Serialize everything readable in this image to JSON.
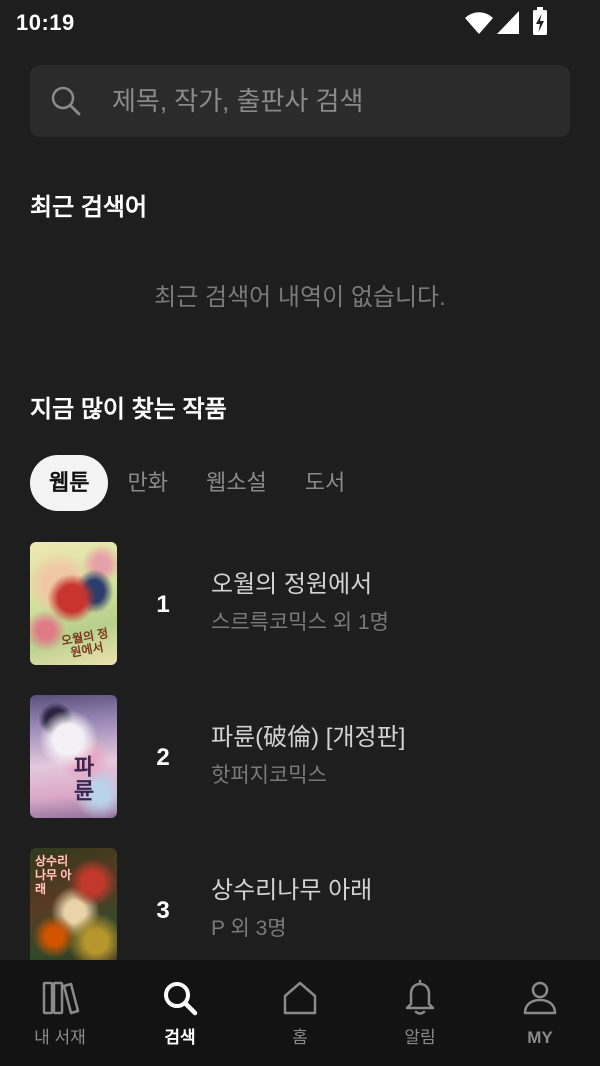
{
  "status_bar": {
    "time": "10:19",
    "icons": [
      "wifi-icon",
      "signal-icon",
      "battery-charging-icon"
    ]
  },
  "search": {
    "placeholder": "제목, 작가, 출판사 검색",
    "value": "",
    "icon": "search-icon"
  },
  "recent_searches": {
    "title": "최근 검색어",
    "empty_message": "최근 검색어 내역이 없습니다."
  },
  "popular": {
    "title": "지금 많이 찾는 작품",
    "tabs": [
      {
        "label": "웹툰",
        "selected": true
      },
      {
        "label": "만화",
        "selected": false
      },
      {
        "label": "웹소설",
        "selected": false
      },
      {
        "label": "도서",
        "selected": false
      }
    ],
    "items": [
      {
        "rank": "1",
        "title": "오월의 정원에서",
        "author": "스르륵코믹스 외 1명",
        "cover_text": "오월의 정원에서"
      },
      {
        "rank": "2",
        "title": "파륜(破倫) [개정판]",
        "author": "핫퍼지코믹스",
        "cover_text": "파륜"
      },
      {
        "rank": "3",
        "title": "상수리나무 아래",
        "author": "P 외 3명",
        "cover_text": "상수리나무 아래"
      }
    ]
  },
  "bottom_nav": {
    "items": [
      {
        "label": "내 서재",
        "icon": "library-icon",
        "active": false
      },
      {
        "label": "검색",
        "icon": "search-icon",
        "active": true
      },
      {
        "label": "홈",
        "icon": "home-icon",
        "active": false
      },
      {
        "label": "알림",
        "icon": "bell-icon",
        "active": false
      },
      {
        "label": "MY",
        "icon": "person-icon",
        "active": false
      }
    ]
  },
  "colors": {
    "background": "#1e1e1e",
    "surface": "#2b2b2b",
    "nav_background": "#131313",
    "text_primary": "#ffffff",
    "text_title": "#d2d2d2",
    "text_secondary": "#8a8a8a",
    "text_muted": "#7a7a7a",
    "pill_background": "#f4f4f4",
    "pill_text": "#111111"
  }
}
